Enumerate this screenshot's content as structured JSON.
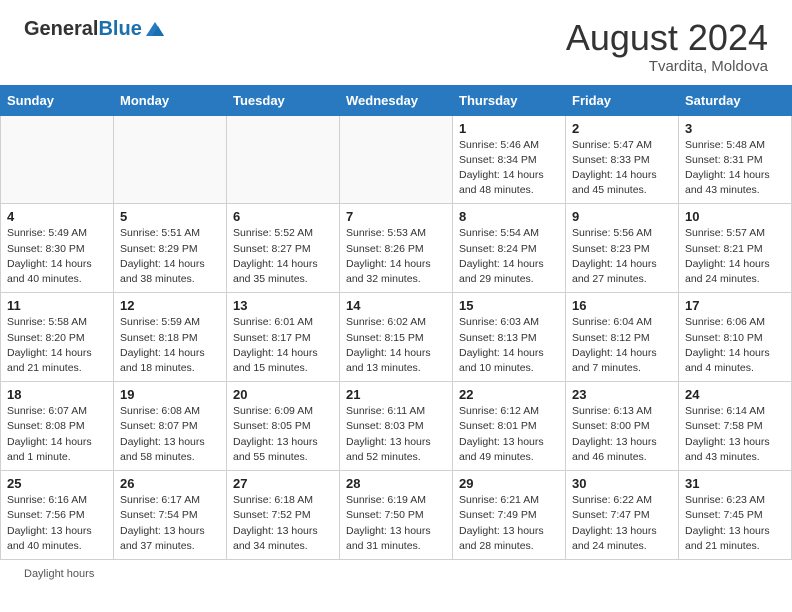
{
  "header": {
    "logo_general": "General",
    "logo_blue": "Blue",
    "month_year": "August 2024",
    "location": "Tvardita, Moldova"
  },
  "weekdays": [
    "Sunday",
    "Monday",
    "Tuesday",
    "Wednesday",
    "Thursday",
    "Friday",
    "Saturday"
  ],
  "weeks": [
    [
      {
        "day": "",
        "info": ""
      },
      {
        "day": "",
        "info": ""
      },
      {
        "day": "",
        "info": ""
      },
      {
        "day": "",
        "info": ""
      },
      {
        "day": "1",
        "info": "Sunrise: 5:46 AM\nSunset: 8:34 PM\nDaylight: 14 hours and 48 minutes."
      },
      {
        "day": "2",
        "info": "Sunrise: 5:47 AM\nSunset: 8:33 PM\nDaylight: 14 hours and 45 minutes."
      },
      {
        "day": "3",
        "info": "Sunrise: 5:48 AM\nSunset: 8:31 PM\nDaylight: 14 hours and 43 minutes."
      }
    ],
    [
      {
        "day": "4",
        "info": "Sunrise: 5:49 AM\nSunset: 8:30 PM\nDaylight: 14 hours and 40 minutes."
      },
      {
        "day": "5",
        "info": "Sunrise: 5:51 AM\nSunset: 8:29 PM\nDaylight: 14 hours and 38 minutes."
      },
      {
        "day": "6",
        "info": "Sunrise: 5:52 AM\nSunset: 8:27 PM\nDaylight: 14 hours and 35 minutes."
      },
      {
        "day": "7",
        "info": "Sunrise: 5:53 AM\nSunset: 8:26 PM\nDaylight: 14 hours and 32 minutes."
      },
      {
        "day": "8",
        "info": "Sunrise: 5:54 AM\nSunset: 8:24 PM\nDaylight: 14 hours and 29 minutes."
      },
      {
        "day": "9",
        "info": "Sunrise: 5:56 AM\nSunset: 8:23 PM\nDaylight: 14 hours and 27 minutes."
      },
      {
        "day": "10",
        "info": "Sunrise: 5:57 AM\nSunset: 8:21 PM\nDaylight: 14 hours and 24 minutes."
      }
    ],
    [
      {
        "day": "11",
        "info": "Sunrise: 5:58 AM\nSunset: 8:20 PM\nDaylight: 14 hours and 21 minutes."
      },
      {
        "day": "12",
        "info": "Sunrise: 5:59 AM\nSunset: 8:18 PM\nDaylight: 14 hours and 18 minutes."
      },
      {
        "day": "13",
        "info": "Sunrise: 6:01 AM\nSunset: 8:17 PM\nDaylight: 14 hours and 15 minutes."
      },
      {
        "day": "14",
        "info": "Sunrise: 6:02 AM\nSunset: 8:15 PM\nDaylight: 14 hours and 13 minutes."
      },
      {
        "day": "15",
        "info": "Sunrise: 6:03 AM\nSunset: 8:13 PM\nDaylight: 14 hours and 10 minutes."
      },
      {
        "day": "16",
        "info": "Sunrise: 6:04 AM\nSunset: 8:12 PM\nDaylight: 14 hours and 7 minutes."
      },
      {
        "day": "17",
        "info": "Sunrise: 6:06 AM\nSunset: 8:10 PM\nDaylight: 14 hours and 4 minutes."
      }
    ],
    [
      {
        "day": "18",
        "info": "Sunrise: 6:07 AM\nSunset: 8:08 PM\nDaylight: 14 hours and 1 minute."
      },
      {
        "day": "19",
        "info": "Sunrise: 6:08 AM\nSunset: 8:07 PM\nDaylight: 13 hours and 58 minutes."
      },
      {
        "day": "20",
        "info": "Sunrise: 6:09 AM\nSunset: 8:05 PM\nDaylight: 13 hours and 55 minutes."
      },
      {
        "day": "21",
        "info": "Sunrise: 6:11 AM\nSunset: 8:03 PM\nDaylight: 13 hours and 52 minutes."
      },
      {
        "day": "22",
        "info": "Sunrise: 6:12 AM\nSunset: 8:01 PM\nDaylight: 13 hours and 49 minutes."
      },
      {
        "day": "23",
        "info": "Sunrise: 6:13 AM\nSunset: 8:00 PM\nDaylight: 13 hours and 46 minutes."
      },
      {
        "day": "24",
        "info": "Sunrise: 6:14 AM\nSunset: 7:58 PM\nDaylight: 13 hours and 43 minutes."
      }
    ],
    [
      {
        "day": "25",
        "info": "Sunrise: 6:16 AM\nSunset: 7:56 PM\nDaylight: 13 hours and 40 minutes."
      },
      {
        "day": "26",
        "info": "Sunrise: 6:17 AM\nSunset: 7:54 PM\nDaylight: 13 hours and 37 minutes."
      },
      {
        "day": "27",
        "info": "Sunrise: 6:18 AM\nSunset: 7:52 PM\nDaylight: 13 hours and 34 minutes."
      },
      {
        "day": "28",
        "info": "Sunrise: 6:19 AM\nSunset: 7:50 PM\nDaylight: 13 hours and 31 minutes."
      },
      {
        "day": "29",
        "info": "Sunrise: 6:21 AM\nSunset: 7:49 PM\nDaylight: 13 hours and 28 minutes."
      },
      {
        "day": "30",
        "info": "Sunrise: 6:22 AM\nSunset: 7:47 PM\nDaylight: 13 hours and 24 minutes."
      },
      {
        "day": "31",
        "info": "Sunrise: 6:23 AM\nSunset: 7:45 PM\nDaylight: 13 hours and 21 minutes."
      }
    ]
  ],
  "footer": {
    "daylight_label": "Daylight hours"
  }
}
